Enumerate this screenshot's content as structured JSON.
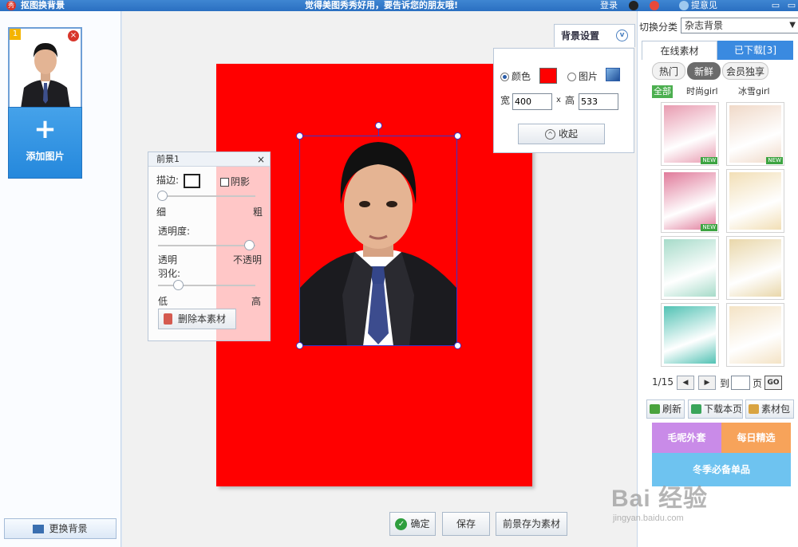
{
  "titlebar": {
    "app_icon": "秀",
    "title": "抠图换背景",
    "slogan": "觉得美图秀秀好用，要告诉您的朋友哦!",
    "login": "登录",
    "feedback": "提意见",
    "icons": [
      "qq-penguin-icon",
      "weibo-icon",
      "feedback-icon",
      "minimize-icon",
      "close-window-icon"
    ],
    "min_glyph": "▭",
    "close_glyph": "▭"
  },
  "sidebar": {
    "thumb_index": "1",
    "thumb_delete": "×",
    "add_plus": "+",
    "add_label": "添加图片",
    "replace_bg_label": "更换背景"
  },
  "foreground_panel": {
    "title": "前景1",
    "close": "×",
    "stroke_label": "描边:",
    "shadow_label": "阴影",
    "stroke_min": "细",
    "stroke_max": "粗",
    "stroke_level": 0.0,
    "opacity_label": "透明度:",
    "opacity_min": "透明",
    "opacity_max": "不透明",
    "opacity_level": 1.0,
    "feather_label": "羽化:",
    "feather_min": "低",
    "feather_max": "高",
    "feather_level": 0.18,
    "delete_label": "删除本素材"
  },
  "bg_settings": {
    "tab_label": "背景设置",
    "chev": "v",
    "color_label": "颜色",
    "image_label": "图片",
    "selected": "color",
    "color": "#ff0000",
    "width_label": "宽",
    "width": "400",
    "times": "x",
    "height_label": "高",
    "height": "533",
    "collapse_label": "收起",
    "collapse_glyph": "^"
  },
  "canvas": {
    "background": "#ff0000"
  },
  "actions": {
    "confirm": "确定",
    "confirm_glyph": "✓",
    "save": "保存",
    "save_fg_material": "前景存为素材"
  },
  "right_panel": {
    "category_label": "切换分类",
    "category_value": "杂志背景",
    "category_arrow": "▼",
    "tabs": [
      "在线素材",
      "已下载[3]"
    ],
    "subtabs": [
      "热门",
      "新鲜",
      "会员独享"
    ],
    "active_subtab": "新鲜",
    "filters": [
      "全部",
      "时尚girl",
      "冰雪girl"
    ],
    "active_filter": "全部",
    "new_badge": "NEW",
    "tiles": [
      {
        "name": "ice-cream-pink",
        "color": "#e89bb0",
        "new": true
      },
      {
        "name": "ice-cream-cream",
        "color": "#f0d9c8",
        "new": true
      },
      {
        "name": "delicious-pink",
        "color": "#e07a9a",
        "new": true
      },
      {
        "name": "vintage-paper",
        "color": "#f2dfb6",
        "new": false
      },
      {
        "name": "floral-mint",
        "color": "#a6dbc9",
        "new": false
      },
      {
        "name": "oval-frame",
        "color": "#e9d7aa",
        "new": false
      },
      {
        "name": "teal-frame",
        "color": "#52c2b4",
        "new": false
      },
      {
        "name": "floral-cream",
        "color": "#f4e3c5",
        "new": false
      }
    ],
    "pager": {
      "current": "1/15",
      "prev": "◀",
      "next": "▶",
      "to_label": "到",
      "page_label": "页",
      "go": "GO"
    },
    "tools": [
      "刷新",
      "下载本页",
      "素材包"
    ],
    "promos": [
      "毛呢外套",
      "每日精选",
      "冬季必备单品"
    ]
  },
  "watermark": {
    "brand": "Bai 经验",
    "url": "jingyan.baidu.com"
  }
}
